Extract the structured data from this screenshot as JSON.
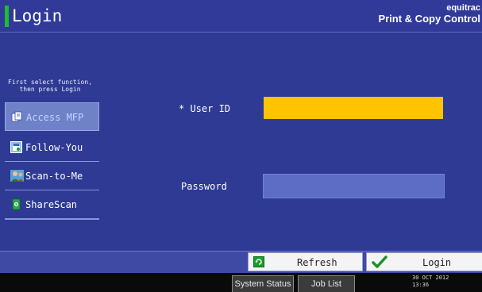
{
  "header": {
    "title": "Login",
    "brand_line1": "equitrac",
    "brand_line2": "Print & Copy Control"
  },
  "sidebar": {
    "instruction_line1": "First select function,",
    "instruction_line2": "then press Login",
    "items": [
      {
        "label": "Access MFP",
        "icon": "document-icon",
        "selected": true
      },
      {
        "label": "Follow-You",
        "icon": "follow-you-icon",
        "selected": false
      },
      {
        "label": "Scan-to-Me",
        "icon": "person-icon",
        "selected": false
      },
      {
        "label": "ShareScan",
        "icon": "sharescan-icon",
        "selected": false
      }
    ]
  },
  "form": {
    "userid_label": "* User ID",
    "userid_value": "",
    "password_label": "Password",
    "password_value": ""
  },
  "buttons": {
    "refresh": "Refresh",
    "login": "Login"
  },
  "statusbar": {
    "system_status": "System Status",
    "job_list": "Job List",
    "date": "30 OCT  2012",
    "time": "13:36"
  },
  "colors": {
    "background": "#2e3a93",
    "userid_field": "#ffc300",
    "accent_green": "#1bbf2e"
  }
}
